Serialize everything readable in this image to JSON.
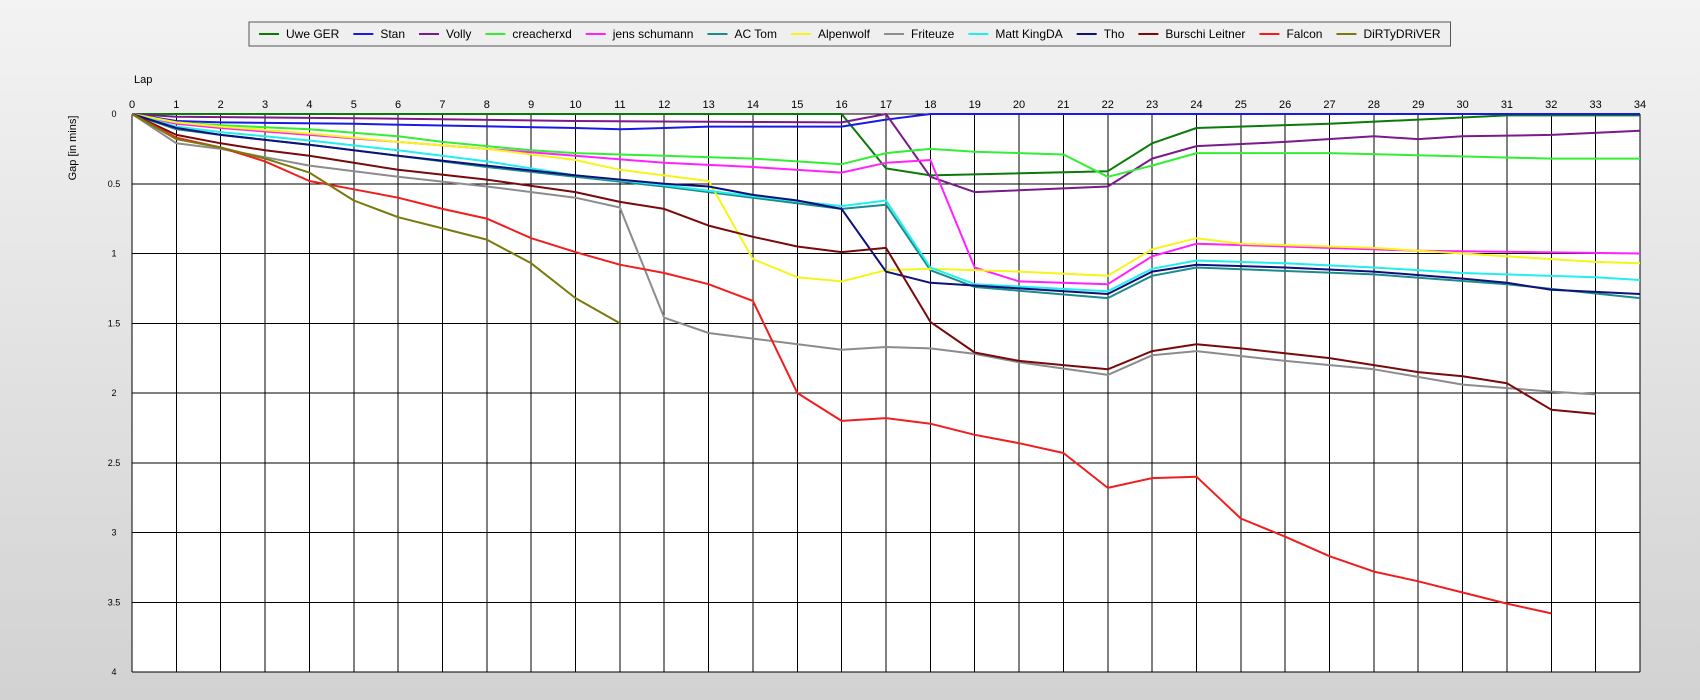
{
  "chart_data": {
    "type": "line",
    "title": "",
    "xlabel": "Lap",
    "ylabel": "Gap [in mins]",
    "xlim": [
      0,
      34
    ],
    "ylim": [
      0,
      4
    ],
    "y_inverted": true,
    "grid": true,
    "legend_position": "top-center",
    "x_ticks": [
      0,
      1,
      2,
      3,
      4,
      5,
      6,
      7,
      8,
      9,
      10,
      11,
      12,
      13,
      14,
      15,
      16,
      17,
      18,
      19,
      20,
      21,
      22,
      23,
      24,
      25,
      26,
      27,
      28,
      29,
      30,
      31,
      32,
      33,
      34
    ],
    "y_ticks": [
      0,
      0.5,
      1,
      1.5,
      2,
      2.5,
      3,
      3.5,
      4
    ],
    "y_tick_labels": [
      "0",
      "0.5",
      "1",
      "1.5",
      "2",
      "2.5",
      "3",
      "3.5",
      "4"
    ],
    "series": [
      {
        "name": "Uwe GER",
        "color": "#0a7a0a",
        "x": [
          0,
          1,
          16,
          17,
          18,
          22,
          23,
          24,
          27,
          31,
          32,
          34
        ],
        "y": [
          0,
          0,
          0,
          0.39,
          0.44,
          0.41,
          0.21,
          0.1,
          0.07,
          0.01,
          0.01,
          0.01
        ]
      },
      {
        "name": "Stan",
        "color": "#1a1ae6",
        "x": [
          0,
          1,
          2,
          5,
          10,
          11,
          12,
          13,
          14,
          16,
          17,
          18,
          34
        ],
        "y": [
          0,
          0.05,
          0.06,
          0.07,
          0.1,
          0.11,
          0.1,
          0.09,
          0.09,
          0.09,
          0.04,
          0,
          0
        ]
      },
      {
        "name": "Volly",
        "color": "#7a1a8c",
        "x": [
          0,
          1,
          5,
          10,
          16,
          17,
          18,
          19,
          22,
          23,
          24,
          26,
          28,
          29,
          30,
          32,
          34
        ],
        "y": [
          0,
          0.02,
          0.03,
          0.05,
          0.06,
          0,
          0.45,
          0.56,
          0.52,
          0.32,
          0.23,
          0.2,
          0.16,
          0.18,
          0.16,
          0.15,
          0.12
        ]
      },
      {
        "name": "creacherxd",
        "color": "#33ee33",
        "x": [
          0,
          1,
          2,
          4,
          6,
          7,
          8,
          9,
          10,
          12,
          14,
          15,
          16,
          17,
          18,
          19,
          21,
          22,
          23,
          24,
          27,
          32,
          34
        ],
        "y": [
          0,
          0.06,
          0.08,
          0.11,
          0.16,
          0.2,
          0.23,
          0.26,
          0.28,
          0.3,
          0.32,
          0.34,
          0.36,
          0.28,
          0.25,
          0.27,
          0.29,
          0.45,
          0.37,
          0.28,
          0.28,
          0.32,
          0.32
        ]
      },
      {
        "name": "jens  schumann",
        "color": "#ff22ff",
        "x": [
          0,
          1,
          2,
          4,
          6,
          8,
          10,
          12,
          14,
          16,
          17,
          18,
          19,
          20,
          22,
          23,
          24,
          26,
          29,
          34
        ],
        "y": [
          0,
          0.07,
          0.1,
          0.15,
          0.2,
          0.25,
          0.3,
          0.35,
          0.38,
          0.42,
          0.35,
          0.33,
          1.1,
          1.2,
          1.22,
          1.02,
          0.93,
          0.95,
          0.98,
          1
        ]
      },
      {
        "name": "AC Tom",
        "color": "#1a8c8c",
        "x": [
          0,
          1,
          2,
          4,
          6,
          8,
          10,
          12,
          14,
          16,
          17,
          18,
          19,
          22,
          23,
          24,
          28,
          31,
          34
        ],
        "y": [
          0,
          0.11,
          0.15,
          0.22,
          0.3,
          0.38,
          0.45,
          0.52,
          0.6,
          0.68,
          0.65,
          1.12,
          1.24,
          1.32,
          1.16,
          1.1,
          1.15,
          1.22,
          1.32
        ]
      },
      {
        "name": "Alpenwolf",
        "color": "#f5f51a",
        "x": [
          0,
          1,
          2,
          4,
          6,
          8,
          10,
          11,
          12,
          13,
          14,
          15,
          16,
          17,
          18,
          20,
          22,
          23,
          24,
          25,
          28,
          32,
          33,
          34
        ],
        "y": [
          0,
          0.06,
          0.09,
          0.14,
          0.2,
          0.25,
          0.33,
          0.4,
          0.44,
          0.48,
          1.04,
          1.17,
          1.2,
          1.12,
          1.11,
          1.13,
          1.16,
          0.97,
          0.89,
          0.93,
          0.96,
          1.04,
          1.06,
          1.07
        ]
      },
      {
        "name": "Friteuze",
        "color": "#8c8c8c",
        "x": [
          0,
          1,
          2,
          3,
          4,
          6,
          8,
          10,
          11,
          12,
          13,
          14,
          16,
          17,
          18,
          19,
          20,
          22,
          23,
          24,
          26,
          28,
          30,
          32,
          33
        ],
        "y": [
          0,
          0.21,
          0.25,
          0.31,
          0.37,
          0.45,
          0.52,
          0.6,
          0.67,
          1.46,
          1.57,
          1.61,
          1.69,
          1.67,
          1.68,
          1.72,
          1.78,
          1.87,
          1.73,
          1.7,
          1.77,
          1.83,
          1.94,
          1.99,
          2.01
        ]
      },
      {
        "name": "Matt KingDA",
        "color": "#22eeee",
        "x": [
          0,
          1,
          2,
          4,
          6,
          8,
          10,
          12,
          14,
          16,
          17,
          18,
          19,
          22,
          23,
          24,
          26,
          28,
          30,
          33,
          34
        ],
        "y": [
          0,
          0.09,
          0.13,
          0.19,
          0.26,
          0.34,
          0.44,
          0.51,
          0.59,
          0.66,
          0.62,
          1.1,
          1.22,
          1.27,
          1.11,
          1.05,
          1.07,
          1.1,
          1.14,
          1.17,
          1.19
        ]
      },
      {
        "name": "Tho",
        "color": "#10107a",
        "x": [
          0,
          1,
          2,
          4,
          6,
          8,
          10,
          12,
          13,
          14,
          15,
          16,
          17,
          18,
          20,
          22,
          23,
          24,
          26,
          28,
          30,
          31,
          32,
          34
        ],
        "y": [
          0,
          0.1,
          0.15,
          0.22,
          0.3,
          0.37,
          0.44,
          0.5,
          0.52,
          0.58,
          0.62,
          0.68,
          1.13,
          1.21,
          1.25,
          1.29,
          1.13,
          1.08,
          1.1,
          1.13,
          1.18,
          1.21,
          1.26,
          1.29
        ]
      },
      {
        "name": "Burschi Leitner",
        "color": "#7a0a0a",
        "x": [
          0,
          1,
          2,
          3,
          4,
          5,
          6,
          8,
          10,
          11,
          12,
          13,
          14,
          15,
          16,
          17,
          18,
          19,
          20,
          21,
          22,
          23,
          24,
          25,
          27,
          28,
          29,
          30,
          31,
          32,
          33
        ],
        "y": [
          0,
          0.15,
          0.21,
          0.26,
          0.3,
          0.35,
          0.4,
          0.47,
          0.56,
          0.63,
          0.68,
          0.8,
          0.88,
          0.95,
          0.99,
          0.96,
          1.49,
          1.71,
          1.77,
          1.8,
          1.83,
          1.7,
          1.65,
          1.68,
          1.75,
          1.8,
          1.85,
          1.88,
          1.93,
          2.12,
          2.15
        ]
      },
      {
        "name": "Falcon",
        "color": "#f01e1e",
        "x": [
          0,
          1,
          2,
          3,
          4,
          5,
          6,
          7,
          8,
          9,
          10,
          11,
          12,
          13,
          14,
          15,
          16,
          17,
          18,
          19,
          20,
          21,
          22,
          23,
          24,
          25,
          26,
          27,
          28,
          29,
          30,
          31,
          32
        ],
        "y": [
          0,
          0.17,
          0.24,
          0.34,
          0.48,
          0.54,
          0.6,
          0.68,
          0.75,
          0.89,
          0.99,
          1.08,
          1.14,
          1.22,
          1.34,
          2,
          2.2,
          2.18,
          2.22,
          2.3,
          2.36,
          2.43,
          2.68,
          2.61,
          2.6,
          2.9,
          3.03,
          3.17,
          3.28,
          3.35,
          3.43,
          3.51,
          3.58
        ]
      },
      {
        "name": "DiRTyDRiVER",
        "color": "#7a7a0a",
        "x": [
          0,
          1,
          2,
          3,
          4,
          5,
          6,
          7,
          8,
          9,
          10,
          11
        ],
        "y": [
          0,
          0.18,
          0.24,
          0.32,
          0.42,
          0.62,
          0.74,
          0.82,
          0.9,
          1.07,
          1.32,
          1.5
        ]
      }
    ]
  }
}
